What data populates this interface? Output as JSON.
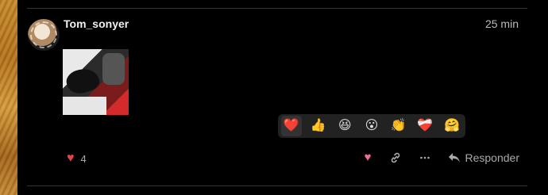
{
  "post": {
    "username": "Tom_sonyer",
    "time": "25 min",
    "like_count": "4",
    "reply_label": "Responder"
  },
  "reaction_picker": {
    "items": [
      {
        "name": "heart",
        "glyph": "❤️"
      },
      {
        "name": "thumbs-up",
        "glyph": "👍"
      },
      {
        "name": "laughing",
        "glyph": "😆"
      },
      {
        "name": "open-mouth",
        "glyph": "😮"
      },
      {
        "name": "clapping",
        "glyph": "👏"
      },
      {
        "name": "heart-mending",
        "glyph": "❤️‍🩹"
      },
      {
        "name": "hug",
        "glyph": "🤗"
      }
    ]
  },
  "colors": {
    "like_heart": "#e8404f",
    "action_heart": "#f06b9a",
    "picker_bg": "#222222"
  }
}
